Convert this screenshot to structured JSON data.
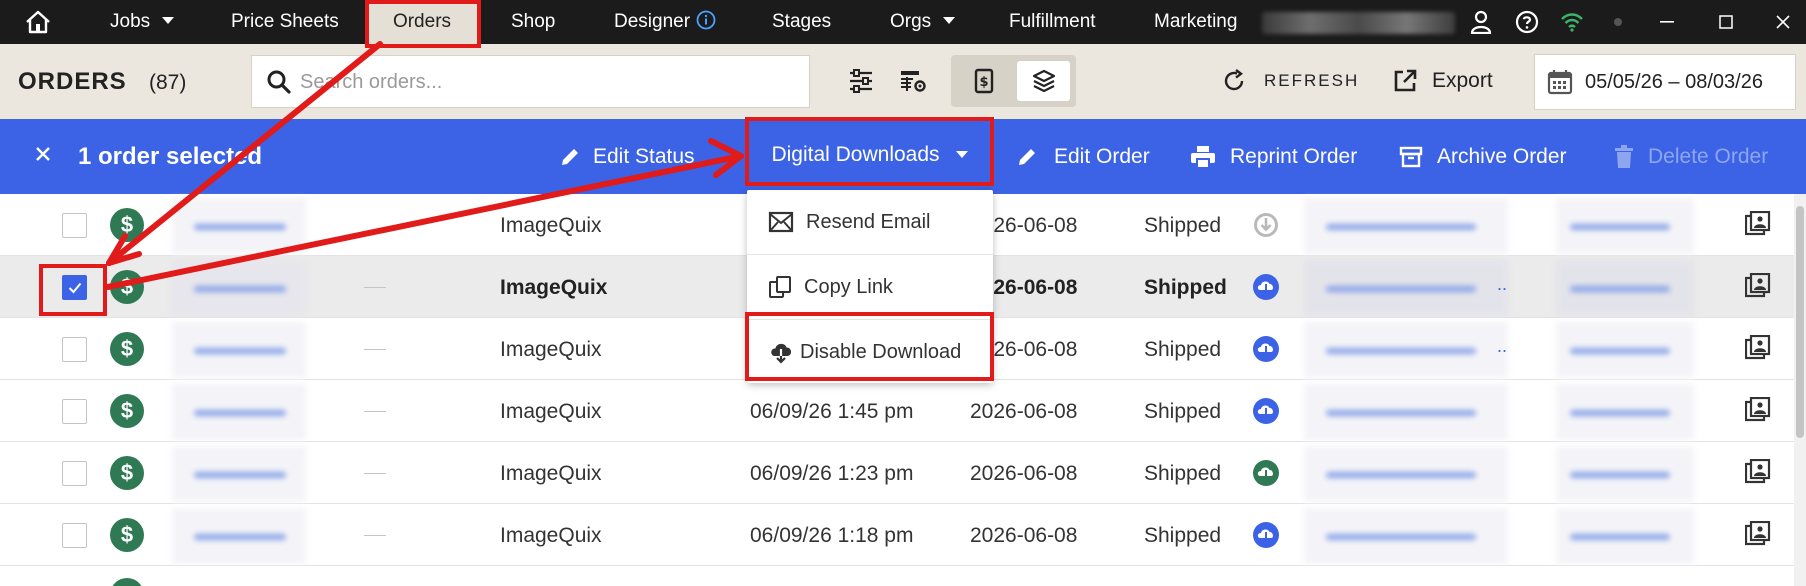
{
  "topnav": {
    "items": [
      {
        "label": "Jobs",
        "dropdown": true
      },
      {
        "label": "Price Sheets"
      },
      {
        "label": "Orders",
        "active": true
      },
      {
        "label": "Shop"
      },
      {
        "label": "Designer",
        "info_icon": true
      },
      {
        "label": "Stages"
      },
      {
        "label": "Orgs",
        "dropdown": true
      },
      {
        "label": "Fulfillment"
      },
      {
        "label": "Marketing"
      }
    ],
    "icons": [
      "home-icon",
      "user-icon",
      "help-icon",
      "wifi-icon",
      "status-dot-icon",
      "minimize-icon",
      "maximize-icon",
      "close-icon"
    ]
  },
  "header": {
    "title": "ORDERS",
    "count": "(87)",
    "search_placeholder": "Search orders...",
    "refresh_label": "REFRESH",
    "export_label": "Export",
    "date_range": "05/05/26 – 08/03/26"
  },
  "selection_bar": {
    "selected_text": "1 order selected",
    "actions": {
      "edit_status": "Edit Status",
      "digital_downloads": "Digital Downloads",
      "edit_order": "Edit Order",
      "reprint_order": "Reprint Order",
      "archive_order": "Archive Order",
      "delete_order": "Delete Order"
    }
  },
  "dropdown_menu": {
    "items": [
      {
        "label": "Resend Email",
        "icon": "email-icon"
      },
      {
        "label": "Copy Link",
        "icon": "copy-icon"
      },
      {
        "label": "Disable Download",
        "icon": "cloud-download-icon"
      }
    ]
  },
  "orders": [
    {
      "source": "ImageQuix",
      "order_date": "",
      "ship_date": "2026-06-08",
      "status": "Shipped",
      "download_icon": "grey",
      "selected": false
    },
    {
      "source": "ImageQuix",
      "order_date": "",
      "ship_date": "2026-06-08",
      "status": "Shipped",
      "download_icon": "blue",
      "selected": true,
      "ellipsis": ".."
    },
    {
      "source": "ImageQuix",
      "order_date": "",
      "ship_date": "2026-06-08",
      "status": "Shipped",
      "download_icon": "blue",
      "selected": false,
      "ellipsis": ".."
    },
    {
      "source": "ImageQuix",
      "order_date": "06/09/26 1:45 pm",
      "ship_date": "2026-06-08",
      "status": "Shipped",
      "download_icon": "blue",
      "selected": false
    },
    {
      "source": "ImageQuix",
      "order_date": "06/09/26 1:23 pm",
      "ship_date": "2026-06-08",
      "status": "Shipped",
      "download_icon": "green",
      "selected": false
    },
    {
      "source": "ImageQuix",
      "order_date": "06/09/26 1:18 pm",
      "ship_date": "2026-06-08",
      "status": "Shipped",
      "download_icon": "blue",
      "selected": false
    }
  ],
  "colors": {
    "nav_bg": "#1b1b1b",
    "accent_blue": "#3c63e6",
    "paid_green": "#2f7a55",
    "annotation_red": "#e11a1a"
  }
}
